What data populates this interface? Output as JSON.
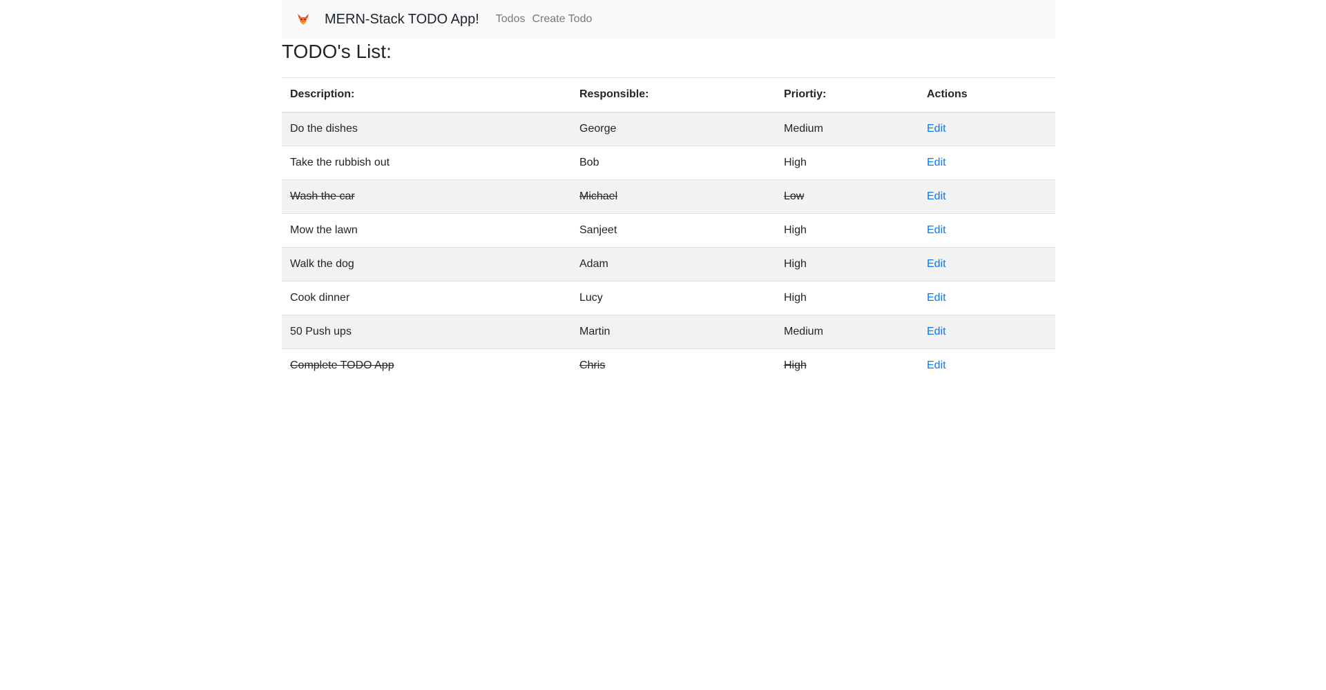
{
  "navbar": {
    "brand": "MERN-Stack TODO App!",
    "logo_icon": "fox-logo-icon",
    "links": [
      "Todos",
      "Create Todo"
    ]
  },
  "page": {
    "title": "TODO's List:"
  },
  "table": {
    "headers": [
      "Description:",
      "Responsible:",
      "Priortiy:",
      "Actions"
    ],
    "rows": [
      {
        "description": "Do the dishes",
        "responsible": "George",
        "priority": "Medium",
        "action": "Edit",
        "completed": false
      },
      {
        "description": "Take the rubbish out",
        "responsible": "Bob",
        "priority": "High",
        "action": "Edit",
        "completed": false
      },
      {
        "description": "Wash the car",
        "responsible": "Michael",
        "priority": "Low",
        "action": "Edit",
        "completed": true
      },
      {
        "description": "Mow the lawn",
        "responsible": "Sanjeet",
        "priority": "High",
        "action": "Edit",
        "completed": false
      },
      {
        "description": "Walk the dog",
        "responsible": "Adam",
        "priority": "High",
        "action": "Edit",
        "completed": false
      },
      {
        "description": "Cook dinner",
        "responsible": "Lucy",
        "priority": "High",
        "action": "Edit",
        "completed": false
      },
      {
        "description": "50 Push ups",
        "responsible": "Martin",
        "priority": "Medium",
        "action": "Edit",
        "completed": false
      },
      {
        "description": "Complete TODO App",
        "responsible": "Chris",
        "priority": "High",
        "action": "Edit",
        "completed": true
      }
    ]
  },
  "colors": {
    "link": "#007bff",
    "navbar_bg": "#f8f9fa",
    "stripe": "#f2f2f2"
  }
}
